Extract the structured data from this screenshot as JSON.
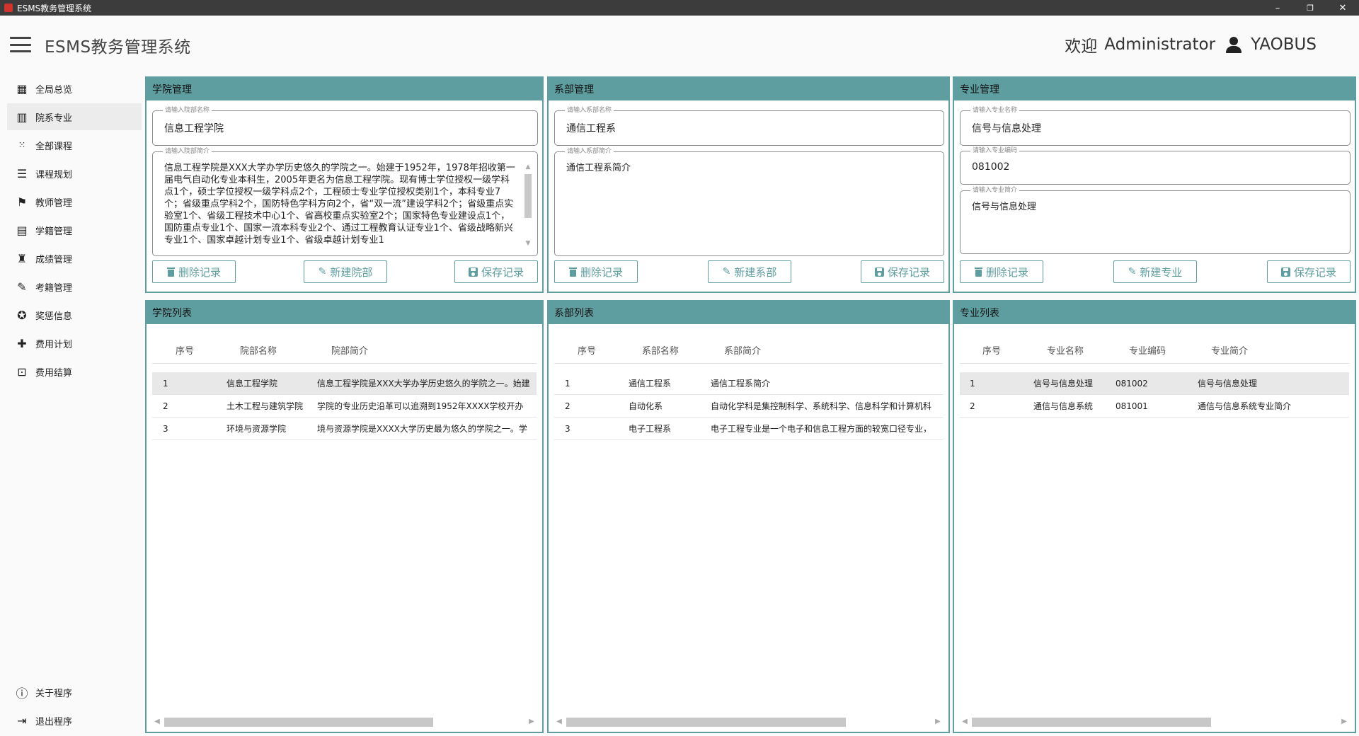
{
  "window": {
    "title": "ESMS教务管理系统",
    "minimize": "–",
    "restore": "❐",
    "close": "✕"
  },
  "header": {
    "app_title": "ESMS教务管理系统",
    "welcome": "欢迎",
    "user_role": "Administrator",
    "user_name": "YAOBUS"
  },
  "sidebar": {
    "items": [
      {
        "label": "全局总览",
        "icon": "dashboard-icon"
      },
      {
        "label": "院系专业",
        "icon": "building-icon"
      },
      {
        "label": "全部课程",
        "icon": "grid-dots-icon"
      },
      {
        "label": "课程规划",
        "icon": "list-icon"
      },
      {
        "label": "教师管理",
        "icon": "teacher-icon"
      },
      {
        "label": "学籍管理",
        "icon": "archive-icon"
      },
      {
        "label": "成绩管理",
        "icon": "trophy-icon"
      },
      {
        "label": "考籍管理",
        "icon": "exam-icon"
      },
      {
        "label": "奖惩信息",
        "icon": "award-icon"
      },
      {
        "label": "费用计划",
        "icon": "plan-icon"
      },
      {
        "label": "费用结算",
        "icon": "money-icon"
      }
    ],
    "bottom": [
      {
        "label": "关于程序",
        "icon": "info-icon"
      },
      {
        "label": "退出程序",
        "icon": "logout-icon"
      }
    ]
  },
  "college_mgmt": {
    "title": "学院管理",
    "name_label": "请输入院部名称",
    "name_value": "信息工程学院",
    "desc_label": "请输入院部简介",
    "desc_value": "信息工程学院是XXX大学办学历史悠久的学院之一。始建于1952年，1978年招收第一届电气自动化专业本科生，2005年更名为信息工程学院。现有博士学位授权一级学科点1个，硕士学位授权一级学科点2个，工程硕士专业学位授权类别1个，本科专业7个；省级重点学科2个，国防特色学科方向2个，省“双一流”建设学科2个；省级重点实验室1个、省级工程技术中心1个、省高校重点实验室2个；国家特色专业建设点1个，国防重点专业1个、国家一流本科专业2个、通过工程教育认证专业1个、省级战略新兴专业1个、国家卓越计划专业1个、省级卓越计划专业1",
    "delete_btn": "删除记录",
    "new_btn": "新建院部",
    "save_btn": "保存记录"
  },
  "dept_mgmt": {
    "title": "系部管理",
    "name_label": "请输入系部名称",
    "name_value": "通信工程系",
    "desc_label": "请输入系部简介",
    "desc_value": "通信工程系简介",
    "delete_btn": "删除记录",
    "new_btn": "新建系部",
    "save_btn": "保存记录"
  },
  "major_mgmt": {
    "title": "专业管理",
    "name_label": "请输入专业名称",
    "name_value": "信号与信息处理",
    "code_label": "请输入专业编码",
    "code_value": "081002",
    "desc_label": "请输入专业简介",
    "desc_value": "信号与信息处理",
    "delete_btn": "删除记录",
    "new_btn": "新建专业",
    "save_btn": "保存记录"
  },
  "college_list": {
    "title": "学院列表",
    "columns": [
      "序号",
      "院部名称",
      "院部简介"
    ],
    "rows": [
      [
        "1",
        "信息工程学院",
        "信息工程学院是XXX大学办学历史悠久的学院之一。始建"
      ],
      [
        "2",
        "土木工程与建筑学院",
        "学院的专业历史沿革可以追溯到1952年XXXX学校开办"
      ],
      [
        "3",
        "环境与资源学院",
        "境与资源学院是XXXX大学历史最为悠久的学院之一。学"
      ]
    ]
  },
  "dept_list": {
    "title": "系部列表",
    "columns": [
      "序号",
      "系部名称",
      "系部简介"
    ],
    "rows": [
      [
        "1",
        "通信工程系",
        "通信工程系简介"
      ],
      [
        "2",
        "自动化系",
        "自动化学科是集控制科学、系统科学、信息科学和计算机科"
      ],
      [
        "3",
        "电子工程系",
        "电子工程专业是一个电子和信息工程方面的较宽口径专业，"
      ]
    ]
  },
  "major_list": {
    "title": "专业列表",
    "columns": [
      "序号",
      "专业名称",
      "专业编码",
      "专业简介"
    ],
    "rows": [
      [
        "1",
        "信号与信息处理",
        "081002",
        "信号与信息处理"
      ],
      [
        "2",
        "通信与信息系统",
        "081001",
        "通信与信息系统专业简介"
      ]
    ]
  },
  "colors": {
    "accent": "#5f9ea0",
    "titlebar": "#3c3c3c",
    "selected_row": "#e8e8e8"
  }
}
